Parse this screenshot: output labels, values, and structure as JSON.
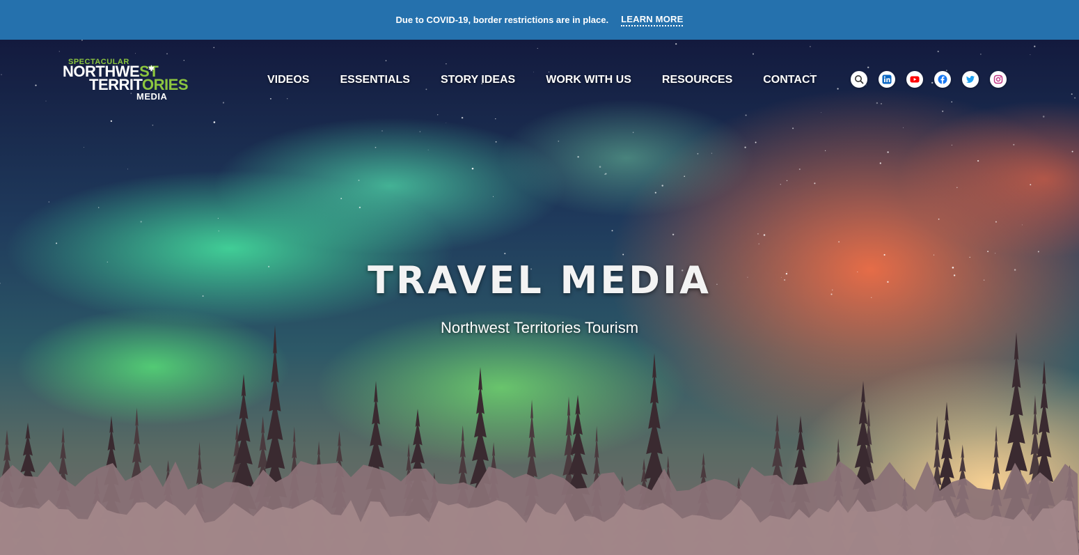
{
  "alert": {
    "message": "Due to COVID-19, border restrictions are in place.",
    "link_label": "LEARN MORE"
  },
  "logo": {
    "line_top": "SPECTACULAR",
    "line1_a": "NORTHWE",
    "line1_b": "ST",
    "line2_a": "TERRIT",
    "line2_b": "ORIES",
    "line3": "MEDIA"
  },
  "nav": {
    "items": [
      {
        "label": "VIDEOS"
      },
      {
        "label": "ESSENTIALS"
      },
      {
        "label": "STORY IDEAS"
      },
      {
        "label": "WORK WITH US"
      },
      {
        "label": "RESOURCES"
      },
      {
        "label": "CONTACT"
      }
    ]
  },
  "social": {
    "icons": [
      "search-icon",
      "linkedin-icon",
      "youtube-icon",
      "facebook-icon",
      "twitter-icon",
      "instagram-icon"
    ]
  },
  "hero": {
    "title": "TRAVEL MEDIA",
    "subtitle": "Northwest Territories Tourism"
  },
  "colors": {
    "alert_bar": "#2571ad",
    "logo_green": "#8cc63f",
    "linkedin": "#0a66c2",
    "youtube": "#ff0000",
    "facebook": "#1877f2",
    "twitter": "#1da1f2",
    "instagram": "#c13584"
  }
}
